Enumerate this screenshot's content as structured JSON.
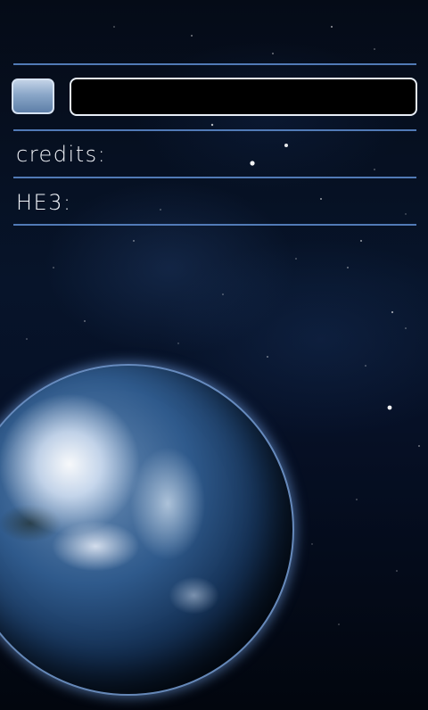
{
  "header": {
    "input_value": ""
  },
  "stats": {
    "credits_label": "credits:",
    "he3_label": "HE3:"
  },
  "colors": {
    "divider": "#5a86c6",
    "field_border": "#e8eef6",
    "button_fill": "#8aa6c8",
    "label_text": "#f2f5fa"
  },
  "icons": {
    "background": "space-earth-background"
  }
}
